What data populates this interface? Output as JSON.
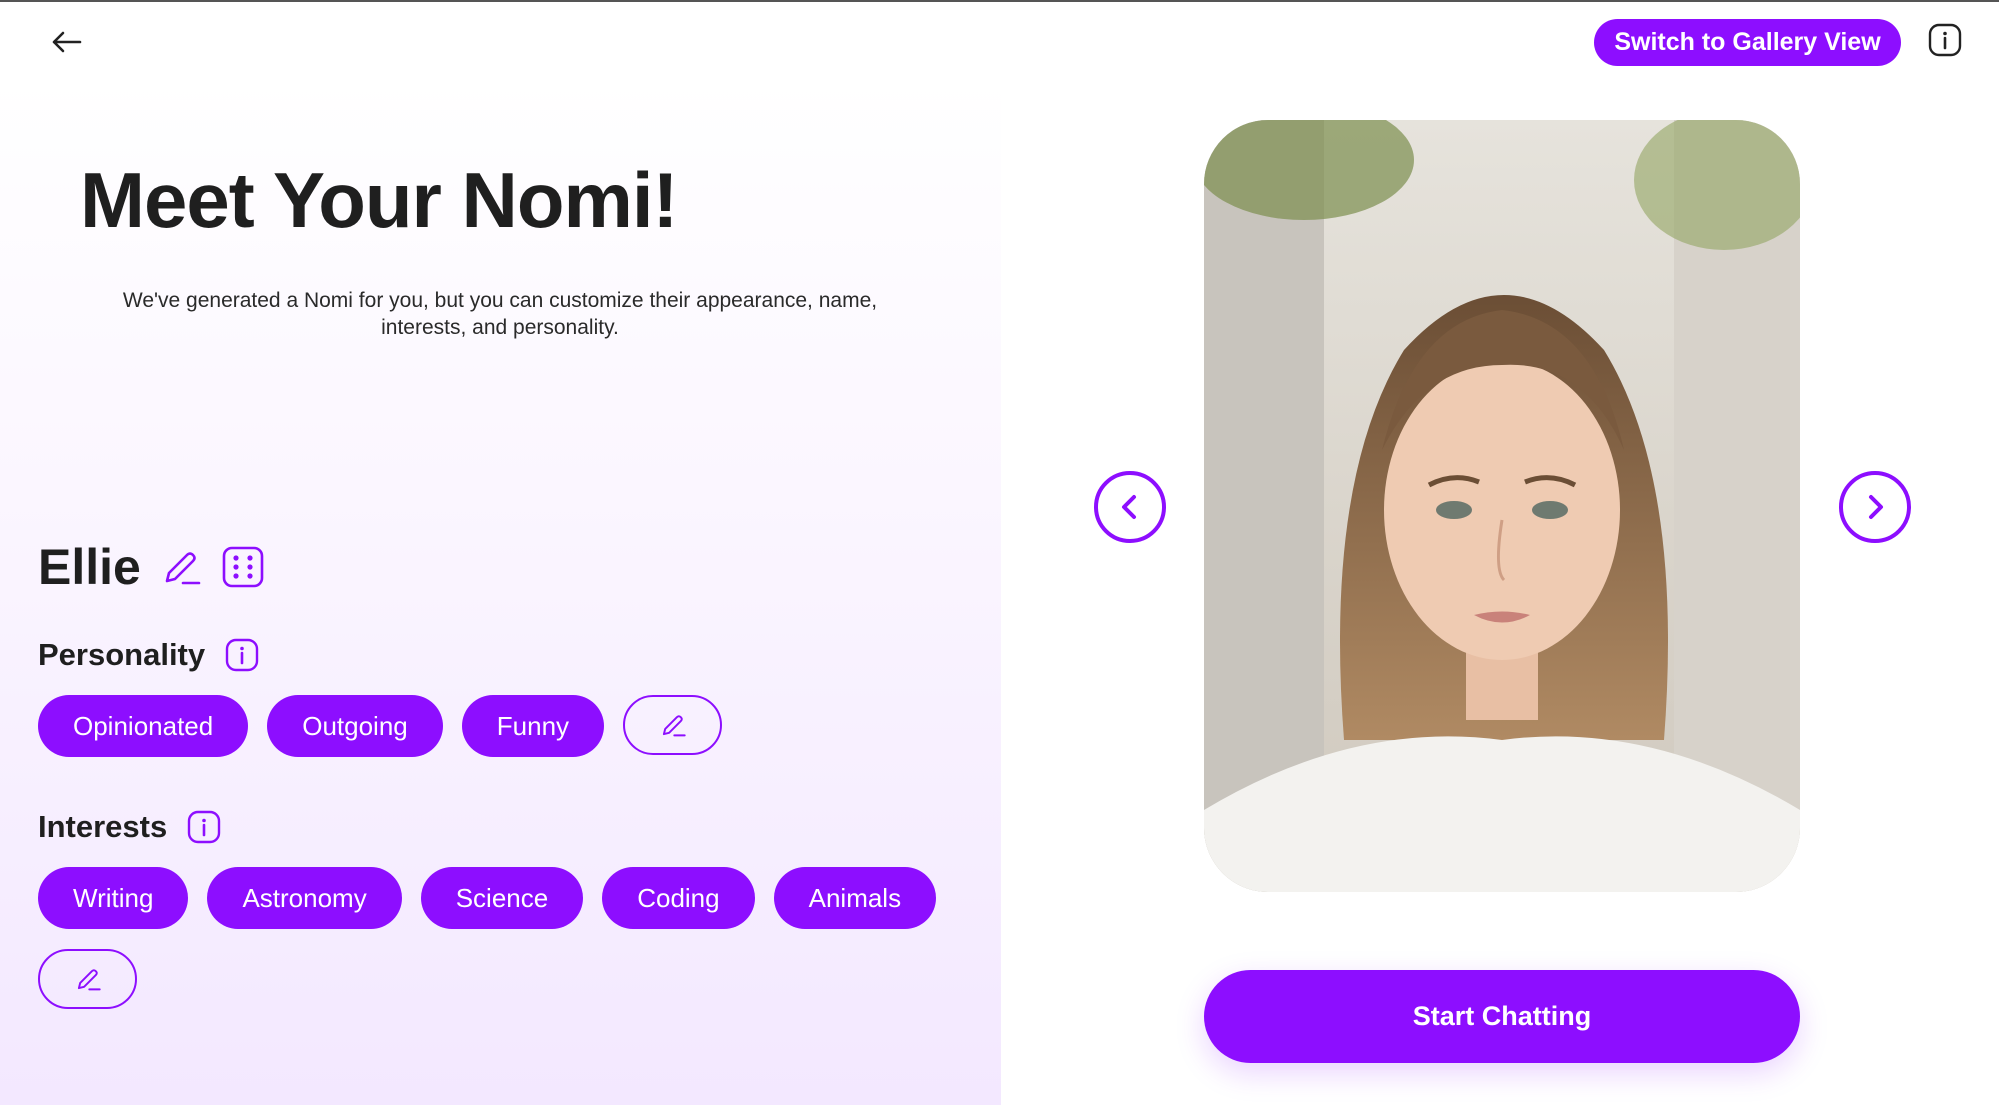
{
  "header": {
    "back_icon": "arrow-left-icon",
    "gallery_button_label": "Switch to Gallery View",
    "info_icon": "info-icon"
  },
  "main": {
    "title": "Meet Your Nomi!",
    "subtitle": "We've generated a Nomi for you, but you can customize their appearance, name, interests, and personality."
  },
  "profile": {
    "name": "Ellie",
    "edit_name_icon": "pencil-icon",
    "randomize_icon": "dice-icon"
  },
  "personality": {
    "label": "Personality",
    "traits": [
      "Opinionated",
      "Outgoing",
      "Funny"
    ],
    "edit_icon": "pencil-icon"
  },
  "interests": {
    "label": "Interests",
    "items": [
      "Writing",
      "Astronomy",
      "Science",
      "Coding",
      "Animals"
    ],
    "edit_icon": "pencil-icon"
  },
  "carousel": {
    "prev_icon": "chevron-left-icon",
    "next_icon": "chevron-right-icon",
    "avatar_description": "portrait"
  },
  "actions": {
    "start_label": "Start Chatting"
  },
  "colors": {
    "accent": "#8d0eff",
    "text": "#1f1f1f",
    "panel_gradient_end": "#f3e8ff"
  }
}
